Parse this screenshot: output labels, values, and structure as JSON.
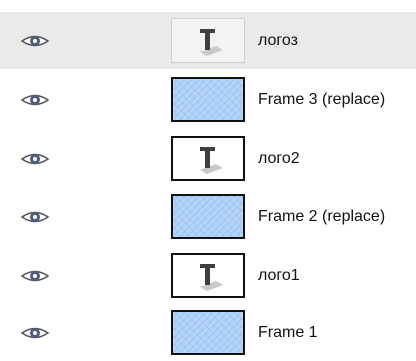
{
  "layers": [
    {
      "name": "логоз",
      "type": "text",
      "visibility_icon": "eye-icon",
      "thumbnail_icon": "text-layer-icon",
      "selected": true
    },
    {
      "name": "Frame 3 (replace)",
      "type": "image",
      "visibility_icon": "eye-icon",
      "thumbnail_icon": "image-layer-icon",
      "selected": false
    },
    {
      "name": "лого2",
      "type": "text",
      "visibility_icon": "eye-icon",
      "thumbnail_icon": "text-layer-icon",
      "selected": false
    },
    {
      "name": "Frame 2 (replace)",
      "type": "image",
      "visibility_icon": "eye-icon",
      "thumbnail_icon": "image-layer-icon",
      "selected": false
    },
    {
      "name": "лого1",
      "type": "text",
      "visibility_icon": "eye-icon",
      "thumbnail_icon": "text-layer-icon",
      "selected": false
    },
    {
      "name": "Frame 1",
      "type": "image",
      "visibility_icon": "eye-icon",
      "thumbnail_icon": "image-layer-icon",
      "selected": false
    }
  ],
  "colors": {
    "selected_row": "#eaeaea",
    "image_thumbnail": "#a9cdf6",
    "eye_iris": "#4d5f7d"
  }
}
